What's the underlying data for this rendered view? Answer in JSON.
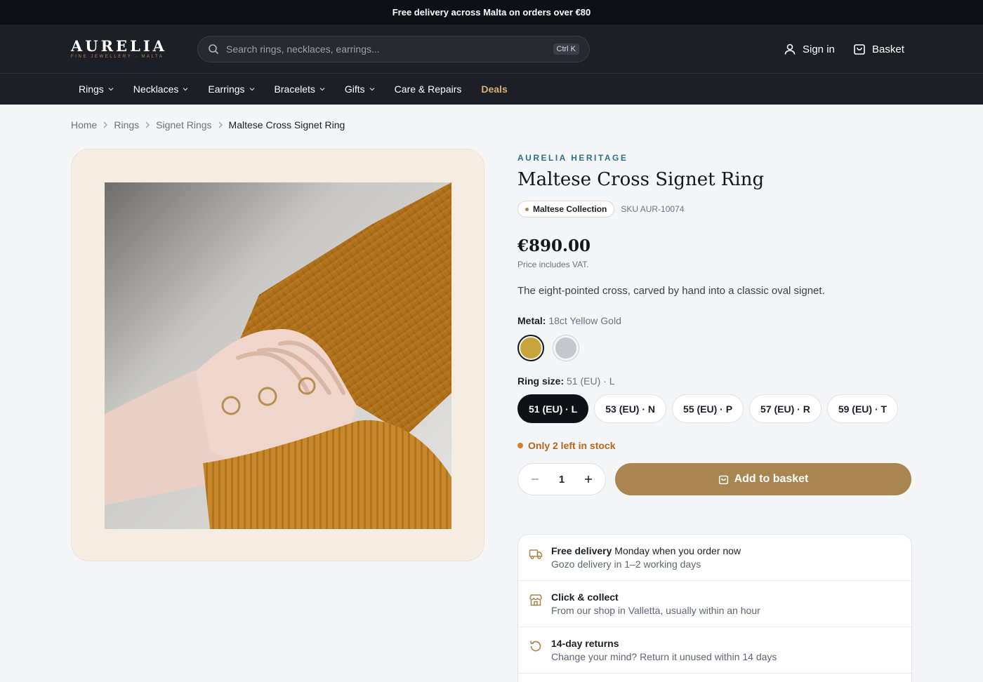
{
  "announcement": "Free delivery across Malta on orders over €80",
  "header": {
    "logo_main": "AURELIA",
    "logo_sub": "FINE JEWELLERY · MALTA",
    "search_placeholder": "Search rings, necklaces, earrings...",
    "search_shortcut": "Ctrl K",
    "signin_label": "Sign in",
    "basket_label": "Basket"
  },
  "nav": [
    {
      "label": "Rings",
      "has_dropdown": true
    },
    {
      "label": "Necklaces",
      "has_dropdown": true
    },
    {
      "label": "Earrings",
      "has_dropdown": true
    },
    {
      "label": "Bracelets",
      "has_dropdown": true
    },
    {
      "label": "Gifts",
      "has_dropdown": true
    },
    {
      "label": "Care & Repairs",
      "has_dropdown": false
    },
    {
      "label": "Deals",
      "has_dropdown": false
    }
  ],
  "breadcrumb": [
    "Home",
    "Rings",
    "Signet Rings",
    "Maltese Cross Signet Ring"
  ],
  "product": {
    "brand": "AURELIA HERITAGE",
    "title": "Maltese Cross Signet Ring",
    "collection": "Maltese Collection",
    "sku": "SKU AUR-10074",
    "price": "€890.00",
    "vat_note": "Price includes VAT.",
    "description": "The eight-pointed cross, carved by hand into a classic oval signet.",
    "metal_label": "Metal:",
    "metal_value": "18ct Yellow Gold",
    "metals": [
      {
        "name": "18ct Yellow Gold",
        "color": "#c9a43a",
        "selected": true
      },
      {
        "name": "Silver",
        "color": "#c4c7cc",
        "selected": false
      }
    ],
    "size_label": "Ring size:",
    "size_value": "51 (EU) · L",
    "sizes": [
      "51 (EU) · L",
      "53 (EU) · N",
      "55 (EU) · P",
      "57 (EU) · R",
      "59 (EU) · T"
    ],
    "stock_note": "Only 2 left in stock",
    "quantity": "1",
    "add_label": "Add to basket"
  },
  "perks": [
    {
      "icon": "truck-icon",
      "title_bold": "Free delivery",
      "title_rest": " Monday when you order now",
      "sub": "Gozo delivery in 1–2 working days"
    },
    {
      "icon": "store-icon",
      "title_bold": "Click & collect",
      "title_rest": "",
      "sub": "From our shop in Valletta, usually within an hour"
    },
    {
      "icon": "returns-icon",
      "title_bold": "14-day returns",
      "title_rest": "",
      "sub": "Change your mind? Return it unused within 14 days"
    }
  ],
  "colors": {
    "accent": "#a98552",
    "header_bg": "#1c1f25",
    "stock": "#d97e22",
    "brand_blue": "#2f6f86"
  }
}
